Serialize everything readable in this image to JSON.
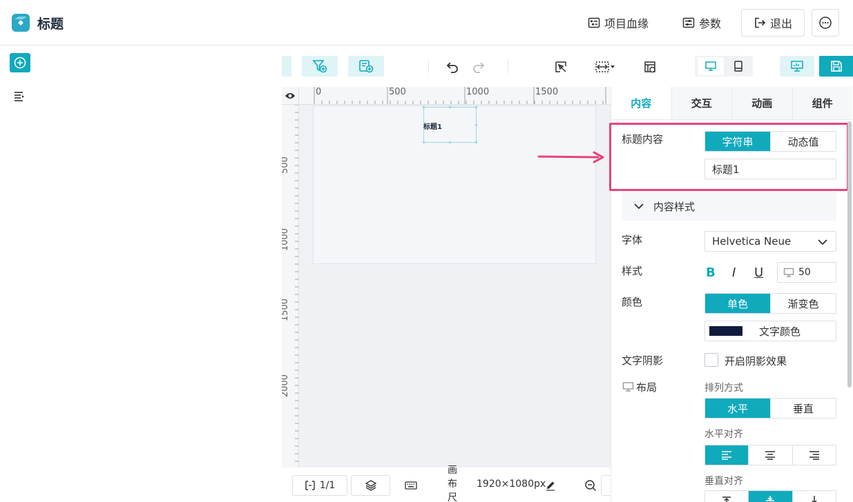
{
  "header": {
    "title": "标题",
    "lineage_label": "项目血缘",
    "params_label": "参数",
    "exit_label": "退出"
  },
  "canvas": {
    "ruler_h_labels": [
      "0",
      "500",
      "1000",
      "1500"
    ],
    "ruler_v_labels": [
      "500",
      "1000",
      "1500",
      "2000"
    ],
    "selected_text": "标题1"
  },
  "bottom": {
    "page_indicator": "1/1",
    "canvas_size_label": "画布尺寸:",
    "canvas_size_value": "1920×1080px"
  },
  "panel": {
    "tabs": [
      "内容",
      "交互",
      "动画",
      "组件"
    ],
    "title_content_label": "标题内容",
    "content_type_options": [
      "字符串",
      "动态值"
    ],
    "title_value": "标题1",
    "content_style_label": "内容样式",
    "font_label": "字体",
    "font_value": "Helvetica Neue",
    "style_label": "样式",
    "bold": "B",
    "italic": "I",
    "underline": "U",
    "font_size": "50",
    "color_label": "颜色",
    "color_options": [
      "单色",
      "渐变色"
    ],
    "text_color_label": "文字颜色",
    "text_color": "#0f1a3d",
    "shadow_label": "文字阴影",
    "shadow_checkbox_label": "开启阴影效果",
    "layout_label": "布局",
    "arrange_label": "排列方式",
    "arrange_options": [
      "水平",
      "垂直"
    ],
    "h_align_label": "水平对齐",
    "v_align_label": "垂直对齐"
  },
  "colors": {
    "accent": "#10aabd",
    "highlight": "#e5447a"
  }
}
